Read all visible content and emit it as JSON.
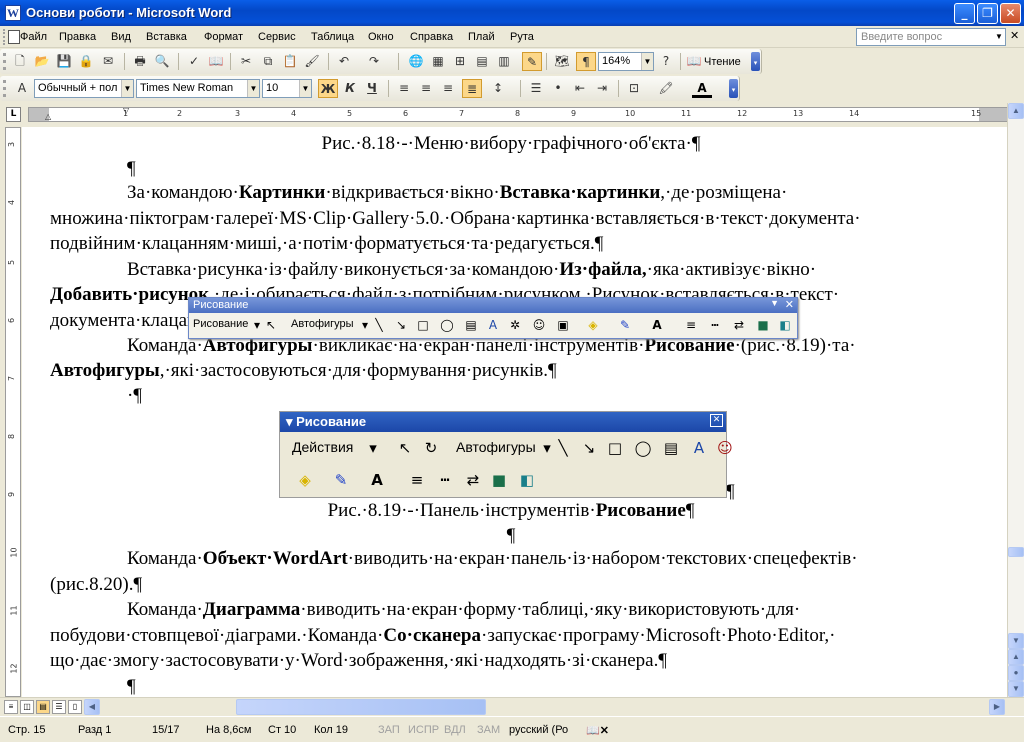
{
  "window": {
    "title": "Основи роботи - Microsoft Word"
  },
  "menu": {
    "items": [
      "Файл",
      "Правка",
      "Вид",
      "Вставка",
      "Формат",
      "Сервис",
      "Таблица",
      "Окно",
      "Справка",
      "Плай",
      "Рута"
    ],
    "help_placeholder": "Введите вопрос"
  },
  "toolbar_standard": {
    "zoom": "164%",
    "read_label": "Чтение"
  },
  "toolbar_formatting": {
    "style": "Обычный + пол",
    "font": "Times New Roman",
    "size": "10",
    "bold": "Ж",
    "italic": "К",
    "underline": "Ч"
  },
  "ruler": {
    "numbers": [
      "1",
      "2",
      "3",
      "4",
      "5",
      "6",
      "7",
      "8",
      "9",
      "10",
      "11",
      "12",
      "13",
      "14",
      "15"
    ],
    "vnumbers": [
      "3",
      "4",
      "5",
      "6",
      "7",
      "8",
      "9",
      "10",
      "11",
      "12"
    ]
  },
  "document": {
    "l1": "Рис.·8.18·-·Меню·вибору·графічного·об'єкта·¶",
    "l2": "¶",
    "p1": {
      "a": "За·командою·",
      "b": "Картинки",
      "c": "·відкривається·вікно·",
      "d": "Вставка·картинки",
      "e": ",·де·розміщена·"
    },
    "l4": "множина·піктограм·галереї·MS·Clip·Gallery·5.0.·Обрана·картинка·вставляється·в·текст·документа·",
    "l5": "подвійним·клацанням·миші,·а·потім·форматується·та·редагується.¶",
    "p2": {
      "a": "Вставка·рисунка·із·файлу·виконується·за·командою·",
      "b": "Из·файла,",
      "c": "·яка·активізує·вікно·"
    },
    "l7": {
      "b": "Добавить·рисунок",
      "c": ",·де·і·обирається·файл·з·потрібним·рисунком.·Рисунок·вставляється·в·текст·"
    },
    "l8": "документа·клацанням·миші.¶",
    "p3": {
      "a": "Команда·",
      "b": "Автофигуры",
      "c": "·викликає·на·екран·панелі·інструментів·",
      "d": "Рисование",
      "e": "·(рис.·8.19)·та·"
    },
    "l10": {
      "b": "Автофигуры",
      "c": ",·які·застосовуються·для·формування·рисунків.¶"
    },
    "l11": "·¶",
    "l12": "¶",
    "caption": {
      "a": "Рис.·8.19·-·Панель·інструментів·",
      "b": "Рисование",
      "c": "¶"
    },
    "l14": "¶",
    "p4": {
      "a": "Команда·",
      "b": "Объект·WordArt",
      "c": "·виводить·на·екран·панель·із·набором·текстових·спецефектів·"
    },
    "l16": "(рис.8.20).¶",
    "p5": {
      "a": "Команда·",
      "b": "Диаграмма",
      "c": "·виводить·на·екран·форму·таблиці,·яку·використовують·для·"
    },
    "l18": {
      "a": "побудови·стовпцевої·діаграми.·Команда·",
      "b": "Со·сканера",
      "c": "·запускає·програму·Microsoft·Photo·Editor,·"
    },
    "l19": "що·дає·змогу·застосовувати·у·Word·зображення,·які·надходять·зі·сканера.¶",
    "l20": "¶"
  },
  "floating_toolbar": {
    "title": "Рисование",
    "actions": "Рисование",
    "autoshapes": "Автофигуры"
  },
  "figure_toolbar": {
    "title": "Рисование",
    "actions": "Действия",
    "autoshapes": "Автофигуры"
  },
  "status": {
    "page": "Стр. 15",
    "section": "Разд 1",
    "pages": "15/17",
    "at": "На 8,6см",
    "line": "Ст 10",
    "col": "Кол 19",
    "rec": "ЗАП",
    "trk": "ИСПР",
    "ext": "ВДЛ",
    "ovr": "ЗАМ",
    "lang": "русский (Ро"
  }
}
